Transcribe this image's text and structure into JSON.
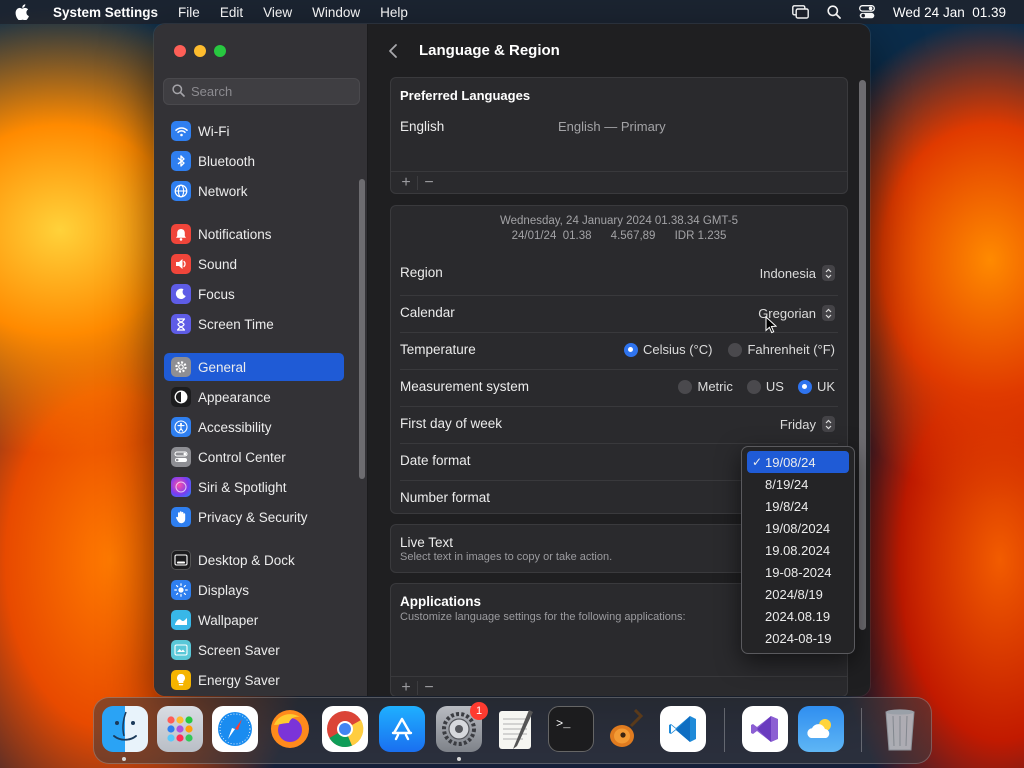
{
  "menubar": {
    "app_name": "System Settings",
    "menus": [
      "File",
      "Edit",
      "View",
      "Window",
      "Help"
    ],
    "clock": "Wed 24 Jan  01.39"
  },
  "sidebar": {
    "search_placeholder": "Search",
    "items": [
      {
        "label": "Wi-Fi",
        "icon": "wifi-icon",
        "color": "#2f7ff0"
      },
      {
        "label": "Bluetooth",
        "icon": "bluetooth-icon",
        "color": "#2f7ff0"
      },
      {
        "label": "Network",
        "icon": "globe-icon",
        "color": "#2f7ff0"
      },
      {
        "label": "Notifications",
        "icon": "bell-icon",
        "color": "#f0453a"
      },
      {
        "label": "Sound",
        "icon": "speaker-icon",
        "color": "#f0453a"
      },
      {
        "label": "Focus",
        "icon": "moon-icon",
        "color": "#5e5ce6"
      },
      {
        "label": "Screen Time",
        "icon": "hourglass-icon",
        "color": "#5e5ce6"
      },
      {
        "label": "General",
        "icon": "gear-icon",
        "color": "#8e8e93"
      },
      {
        "label": "Appearance",
        "icon": "appearance-icon",
        "color": "#1c1c1e"
      },
      {
        "label": "Accessibility",
        "icon": "accessibility-icon",
        "color": "#2f7ff0"
      },
      {
        "label": "Control Center",
        "icon": "control-center-icon",
        "color": "#8e8e93"
      },
      {
        "label": "Siri & Spotlight",
        "icon": "siri-icon",
        "color": "#7a3cf0"
      },
      {
        "label": "Privacy & Security",
        "icon": "hand-icon",
        "color": "#2f7ff0"
      },
      {
        "label": "Desktop & Dock",
        "icon": "dock-icon",
        "color": "#1c1c1e"
      },
      {
        "label": "Displays",
        "icon": "sun-icon",
        "color": "#2f7ff0"
      },
      {
        "label": "Wallpaper",
        "icon": "wallpaper-icon",
        "color": "#38b7e8"
      },
      {
        "label": "Screen Saver",
        "icon": "screensaver-icon",
        "color": "#5ac8d8"
      },
      {
        "label": "Energy Saver",
        "icon": "bulb-icon",
        "color": "#f5b400"
      }
    ],
    "active": "General"
  },
  "page": {
    "title": "Language & Region",
    "preferred_languages": {
      "title": "Preferred Languages",
      "language": "English",
      "language_detail": "English — Primary",
      "add": "+",
      "remove": "−"
    },
    "summary": {
      "line1": "Wednesday, 24 January 2024 01.38.34 GMT-5",
      "line2": "24/01/24  01.38      4.567,89      IDR 1.235"
    },
    "region": {
      "label": "Region",
      "value": "Indonesia"
    },
    "calendar": {
      "label": "Calendar",
      "value": "Gregorian"
    },
    "temperature": {
      "label": "Temperature",
      "options": [
        {
          "label": "Celsius (°C)",
          "selected": true
        },
        {
          "label": "Fahrenheit (°F)",
          "selected": false
        }
      ]
    },
    "measurement": {
      "label": "Measurement system",
      "options": [
        {
          "label": "Metric",
          "selected": false
        },
        {
          "label": "US",
          "selected": false
        },
        {
          "label": "UK",
          "selected": true
        }
      ]
    },
    "first_day": {
      "label": "First day of week",
      "value": "Friday"
    },
    "date_format": {
      "label": "Date format"
    },
    "number_format": {
      "label": "Number format"
    },
    "live_text": {
      "title": "Live Text",
      "subtitle": "Select text in images to copy or take action."
    },
    "applications": {
      "title": "Applications",
      "subtitle": "Customize language settings for the following applications:",
      "add": "+",
      "remove": "−"
    }
  },
  "date_format_menu": {
    "selected_index": 0,
    "check": "✓",
    "options": [
      "19/08/24",
      "8/19/24",
      "19/8/24",
      "19/08/2024",
      "19.08.2024",
      "19-08-2024",
      "2024/8/19",
      "2024.08.19",
      "2024-08-19"
    ]
  },
  "dock": {
    "items": [
      {
        "name": "finder",
        "icon": "finder-icon",
        "running": true
      },
      {
        "name": "launchpad",
        "icon": "launchpad-icon",
        "running": false
      },
      {
        "name": "safari",
        "icon": "safari-icon",
        "running": false
      },
      {
        "name": "firefox",
        "icon": "firefox-icon",
        "running": false
      },
      {
        "name": "chrome",
        "icon": "chrome-icon",
        "running": false
      },
      {
        "name": "app-store",
        "icon": "app-store-icon",
        "running": false
      },
      {
        "name": "system-settings",
        "icon": "system-settings-icon",
        "running": true,
        "badge": "1"
      },
      {
        "name": "textedit",
        "icon": "textedit-icon",
        "running": false
      },
      {
        "name": "terminal",
        "icon": "terminal-icon",
        "running": false
      },
      {
        "name": "garageband",
        "icon": "guitar-icon",
        "running": false
      },
      {
        "name": "vscode",
        "icon": "vscode-icon",
        "running": false
      },
      {
        "name": "visual-studio",
        "icon": "visual-studio-icon",
        "running": false
      },
      {
        "name": "weather",
        "icon": "weather-icon",
        "running": false
      },
      {
        "name": "trash",
        "icon": "trash-icon",
        "running": false
      }
    ]
  },
  "colors": {
    "accent": "#1f5bd6",
    "radio_on": "#2f74ef"
  }
}
